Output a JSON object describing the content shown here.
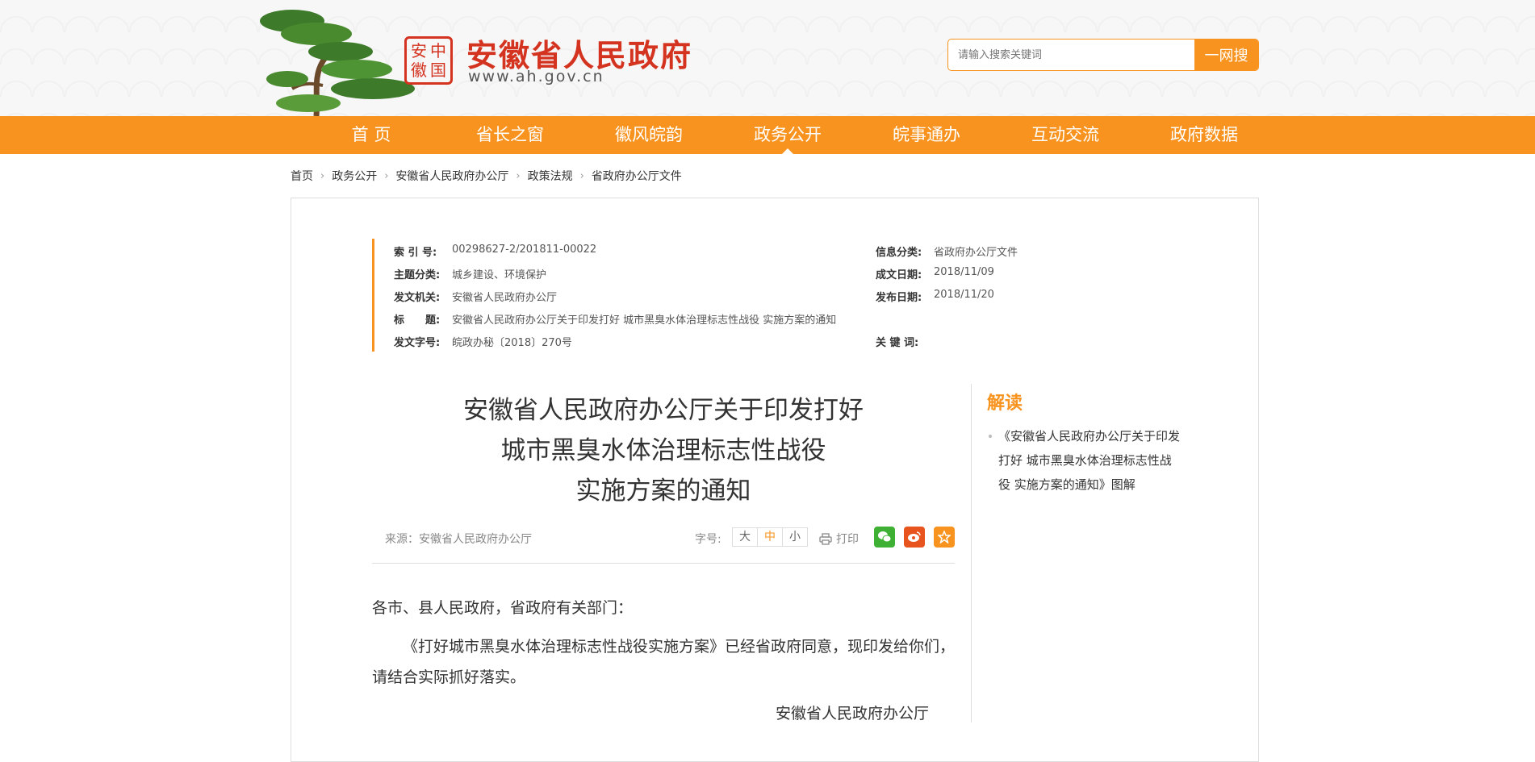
{
  "header": {
    "seal_chars": [
      "安",
      "中",
      "徽",
      "国"
    ],
    "site_title": "安徽省人民政府",
    "site_url": "www.ah.gov.cn",
    "search_placeholder": "请输入搜索关键词",
    "search_button": "一网搜"
  },
  "nav": {
    "items": [
      {
        "label": "首 页"
      },
      {
        "label": "省长之窗"
      },
      {
        "label": "徽风皖韵"
      },
      {
        "label": "政务公开",
        "active": true
      },
      {
        "label": "皖事通办"
      },
      {
        "label": "互动交流"
      },
      {
        "label": "政府数据"
      }
    ]
  },
  "breadcrumb": [
    "首页",
    "政务公开",
    "安徽省人民政府办公厅",
    "政策法规",
    "省政府办公厅文件"
  ],
  "meta": {
    "index_label": "索 引 号:",
    "index_value": "00298627-2/201811-00022",
    "category_label": "信息分类:",
    "category_value": "省政府办公厅文件",
    "topic_label": "主题分类:",
    "topic_value": "城乡建设、环境保护",
    "created_label": "成文日期:",
    "created_value": "2018/11/09",
    "issuer_label": "发文机关:",
    "issuer_value": "安徽省人民政府办公厅",
    "published_label": "发布日期:",
    "published_value": "2018/11/20",
    "title_label": "标　　题:",
    "title_value": "安徽省人民政府办公厅关于印发打好 城市黑臭水体治理标志性战役 实施方案的通知",
    "doc_no_label": "发文字号:",
    "doc_no_value": "皖政办秘〔2018〕270号",
    "keywords_label": "关 键 词:",
    "keywords_value": ""
  },
  "article": {
    "title_line1": "安徽省人民政府办公厅关于印发打好",
    "title_line2": "城市黑臭水体治理标志性战役",
    "title_line3": "实施方案的通知",
    "source": "来源：安徽省人民政府办公厅",
    "font_size_label": "字号:",
    "font_sizes": [
      "大",
      "中",
      "小"
    ],
    "print_label": "打印",
    "para1": "各市、县人民政府，省政府有关部门：",
    "para2": "《打好城市黑臭水体治理标志性战役实施方案》已经省政府同意，现印发给你们，请结合实际抓好落实。",
    "signature": "安徽省人民政府办公厅"
  },
  "sidebar": {
    "title": "解读",
    "items": [
      "《安徽省人民政府办公厅关于印发打好 城市黑臭水体治理标志性战役 实施方案的通知》图解"
    ]
  },
  "colors": {
    "accent": "#f7931e",
    "brand_red": "#d3331f"
  }
}
